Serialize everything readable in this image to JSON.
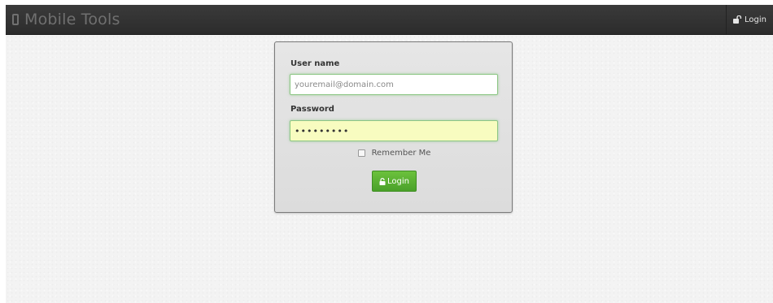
{
  "navbar": {
    "brand_icon": "mobile-phone-icon",
    "brand_title": "Mobile Tools",
    "login_icon": "unlock-icon",
    "login_label": "Login"
  },
  "login_form": {
    "username_label": "User name",
    "username_placeholder": "youremail@domain.com",
    "username_value": "",
    "password_label": "Password",
    "password_value": "•••••••••",
    "remember_label": "Remember Me",
    "remember_checked": false,
    "submit_icon": "lock-icon",
    "submit_label": "Login"
  },
  "colors": {
    "navbar_bg": "#333333",
    "brand_text": "#707070",
    "button_green": "#5cb432",
    "password_autofill_bg": "#f8fcc0",
    "focus_border": "#8cc684"
  }
}
